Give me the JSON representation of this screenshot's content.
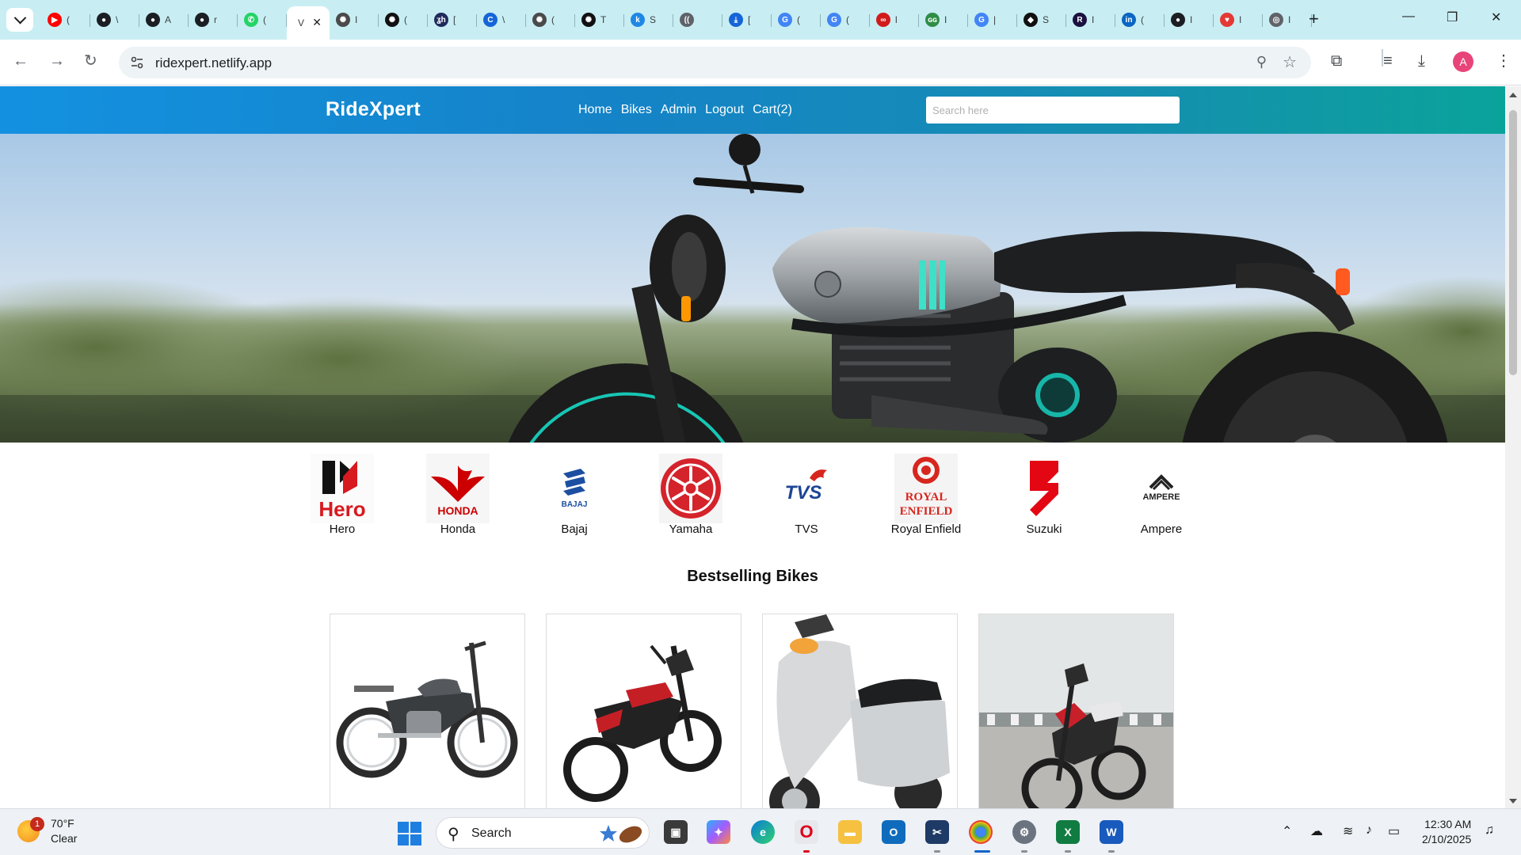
{
  "browser": {
    "active_tab_title": "V",
    "tabs": [
      {
        "icon": "youtube-icon",
        "color": "#ff0000",
        "glyph": "▶",
        "title": "("
      },
      {
        "icon": "github-icon",
        "color": "#1b1f23",
        "glyph": "●",
        "title": "\\"
      },
      {
        "icon": "github-icon",
        "color": "#1b1f23",
        "glyph": "●",
        "title": "A"
      },
      {
        "icon": "github-icon",
        "color": "#1b1f23",
        "glyph": "●",
        "title": "r"
      },
      {
        "icon": "whatsapp-icon",
        "color": "#25d366",
        "glyph": "✆",
        "title": "("
      },
      {
        "icon": "openai-icon",
        "color": "#4a4a4a",
        "glyph": "✺",
        "title": "I"
      },
      {
        "icon": "openai-icon",
        "color": "#111111",
        "glyph": "✺",
        "title": "("
      },
      {
        "icon": "gfg-icon",
        "color": "#1f2a5c",
        "glyph": "ʓh",
        "title": "["
      },
      {
        "icon": "c-icon",
        "color": "#1565d8",
        "glyph": "C",
        "title": "\\"
      },
      {
        "icon": "openai-icon",
        "color": "#4a4a4a",
        "glyph": "✺",
        "title": "("
      },
      {
        "icon": "openai-icon",
        "color": "#111111",
        "glyph": "✺",
        "title": "T"
      },
      {
        "icon": "k-icon",
        "color": "#1e88e5",
        "glyph": "k",
        "title": "S"
      },
      {
        "icon": "audio-icon",
        "color": "#5f6368",
        "glyph": "((",
        "title": ""
      },
      {
        "icon": "download-icon",
        "color": "#1565d8",
        "glyph": "⤓",
        "title": "["
      },
      {
        "icon": "google-icon",
        "color": "#4285f4",
        "glyph": "G",
        "title": "("
      },
      {
        "icon": "google-icon",
        "color": "#4285f4",
        "glyph": "G",
        "title": "("
      },
      {
        "icon": "infinity-icon",
        "color": "#d11b1b",
        "glyph": "∞",
        "title": "l"
      },
      {
        "icon": "gfg-icon",
        "color": "#2f8d46",
        "glyph": "ɢɢ",
        "title": "I"
      },
      {
        "icon": "google-icon",
        "color": "#4285f4",
        "glyph": "G",
        "title": "|"
      },
      {
        "icon": "shield-icon",
        "color": "#111111",
        "glyph": "◆",
        "title": "S"
      },
      {
        "icon": "r-icon",
        "color": "#1b1040",
        "glyph": "R",
        "title": "I"
      },
      {
        "icon": "linkedin-icon",
        "color": "#0a66c2",
        "glyph": "in",
        "title": "("
      },
      {
        "icon": "github-icon",
        "color": "#1b1f23",
        "glyph": "●",
        "title": "I"
      },
      {
        "icon": "heart-icon",
        "color": "#e53935",
        "glyph": "♥",
        "title": "I"
      },
      {
        "icon": "chrome-icon",
        "color": "#5f6368",
        "glyph": "◎",
        "title": "I"
      }
    ],
    "url": "ridexpert.netlify.app",
    "profile_initial": "A"
  },
  "site": {
    "brand": "RideXpert",
    "nav": [
      "Home",
      "Bikes",
      "Admin",
      "Logout",
      "Cart(2)"
    ],
    "search_placeholder": "Search here",
    "brands": [
      {
        "name": "Hero",
        "color": "#d71920"
      },
      {
        "name": "Honda",
        "color": "#cc0000"
      },
      {
        "name": "Bajaj",
        "color": "#1c4fa1"
      },
      {
        "name": "Yamaha",
        "color": "#d4232b"
      },
      {
        "name": "TVS",
        "color": "#1d4595"
      },
      {
        "name": "Royal Enfield",
        "color": "#d7261e"
      },
      {
        "name": "Suzuki",
        "color": "#e30613"
      },
      {
        "name": "Ampere",
        "color": "#222222"
      }
    ],
    "logo_text": {
      "hero": "Hero",
      "honda": "HONDA",
      "bajaj": "BAJAJ",
      "tvs": "TVS",
      "royal_enfield_1": "ROYAL",
      "royal_enfield_2": "ENFIELD",
      "ampere": "AMPERE"
    },
    "bestselling_title": "Bestselling Bikes",
    "bestselling": [
      {
        "name": "commuter-black-bike"
      },
      {
        "name": "sport-red-black-bike"
      },
      {
        "name": "silver-scooter"
      },
      {
        "name": "red-white-street-bike"
      }
    ]
  },
  "taskbar": {
    "weather_temp": "70°F",
    "weather_condition": "Clear",
    "weather_badge": "1",
    "search_label": "Search",
    "time": "12:30 AM",
    "date": "2/10/2025"
  }
}
